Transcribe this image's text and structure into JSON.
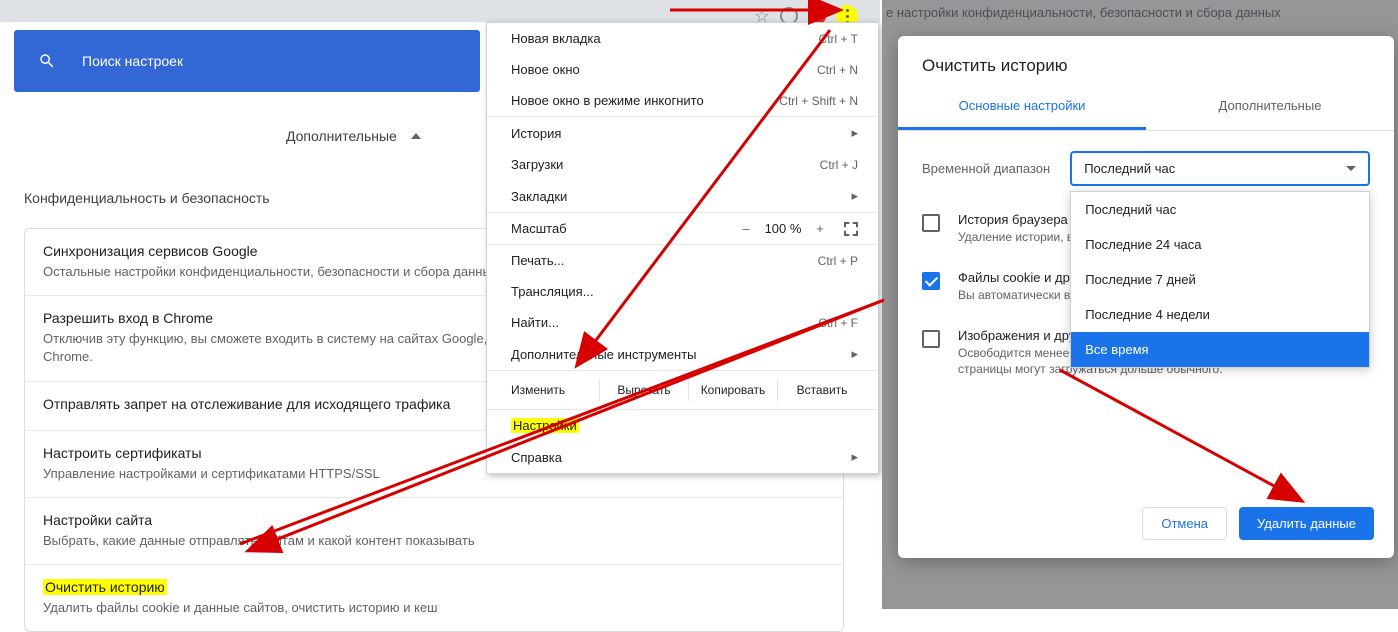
{
  "search": {
    "placeholder": "Поиск настроек"
  },
  "advanced": "Дополнительные",
  "sectionTitle": "Конфиденциальность и безопасность",
  "bgText": "е настройки конфиденциальности, безопасности и сбора данных",
  "rows": [
    {
      "t": "Синхронизация сервисов Google",
      "d": "Остальные настройки конфиденциальности, безопасности и сбора данных"
    },
    {
      "t": "Разрешить вход в Chrome",
      "d": "Отключив эту функцию, вы сможете входить в систему на сайтах Google, например Gmail, без необходимости выполнять вход в Chrome."
    },
    {
      "t": "Отправлять запрет на отслеживание для исходящего трафика",
      "d": ""
    },
    {
      "t": "Настроить сертификаты",
      "d": "Управление настройками и сертификатами HTTPS/SSL"
    },
    {
      "t": "Настройки сайта",
      "d": "Выбрать, какие данные отправлять сайтам и какой контент показывать"
    },
    {
      "t": "Очистить историю",
      "d": "Удалить файлы cookie и данные сайтов, очистить историю и кеш"
    }
  ],
  "menu": {
    "newTab": {
      "l": "Новая вкладка",
      "s": "Ctrl + T"
    },
    "newWin": {
      "l": "Новое окно",
      "s": "Ctrl + N"
    },
    "incog": {
      "l": "Новое окно в режиме инкогнито",
      "s": "Ctrl + Shift + N"
    },
    "history": {
      "l": "История"
    },
    "downloads": {
      "l": "Загрузки",
      "s": "Ctrl + J"
    },
    "bookmarks": {
      "l": "Закладки"
    },
    "zoom": {
      "l": "Масштаб",
      "pct": "100 %"
    },
    "print": {
      "l": "Печать...",
      "s": "Ctrl + P"
    },
    "cast": {
      "l": "Трансляция..."
    },
    "find": {
      "l": "Найти...",
      "s": "Ctrl + F"
    },
    "tools": {
      "l": "Дополнительные инструменты"
    },
    "edit": {
      "l": "Изменить",
      "a": "Вырезать",
      "b": "Копировать",
      "c": "Вставить"
    },
    "settings": {
      "l": "Настройки"
    },
    "help": {
      "l": "Справка"
    }
  },
  "modal": {
    "title": "Очистить историю",
    "tab1": "Основные настройки",
    "tab2": "Дополнительные",
    "rangeLabel": "Временной диапазон",
    "rangeValue": "Последний час",
    "options": [
      "Последний час",
      "Последние 24 часа",
      "Последние 7 дней",
      "Последние 4 недели",
      "Все время"
    ],
    "c1": {
      "t": "История браузера",
      "d": "Удаление истории, в том числе из поиска, поиска в адресной строке"
    },
    "c2": {
      "t": "Файлы cookie и другие данные сайтов",
      "d": "Вы автоматически выйдете из аккаунтов на большинстве сайтов."
    },
    "c3": {
      "t": "Изображения и другие файлы, сохраненные в кеше",
      "d": "Освободится менее 319 МБ пространства. После этого некоторые веб-страницы могут загружаться дольше обычного."
    },
    "cancel": "Отмена",
    "delete": "Удалить данные"
  }
}
